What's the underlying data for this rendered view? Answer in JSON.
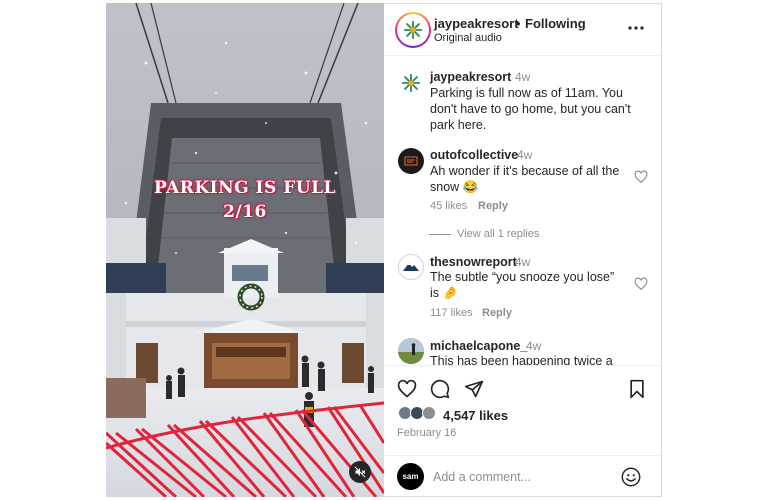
{
  "video": {
    "overlay_line1": "PARKING IS FULL",
    "overlay_line2": "2/16",
    "mute_icon": "speaker-muted-icon"
  },
  "header": {
    "username": "jaypeakresort",
    "separator": "•",
    "follow_status": "Following",
    "audio": "Original audio",
    "more_icon": "more-horizontal-icon"
  },
  "caption": {
    "username": "jaypeakresort",
    "time": "4w",
    "text": "Parking is full now as of 11am. You don't have to go home, but you can't park here."
  },
  "comments": [
    {
      "username": "outofcollective",
      "time": "4w",
      "text": "Ah wonder if it's because of all the snow 😂",
      "likes": "45 likes",
      "reply": "Reply",
      "view_replies": "View all 1 replies"
    },
    {
      "username": "thesnowreport",
      "time": "4w",
      "text": "The subtle “you snooze you lose” is 🤌",
      "likes": "117 likes",
      "reply": "Reply"
    },
    {
      "username": "michaelcapone_",
      "time": "4w",
      "text": "This has been happening twice a"
    }
  ],
  "actions": {
    "like_icon": "heart-icon",
    "comment_icon": "comment-icon",
    "share_icon": "paper-plane-icon",
    "save_icon": "bookmark-icon",
    "likes_count": "4,547 likes",
    "date": "February 16"
  },
  "add_comment": {
    "avatar_text": "sam",
    "placeholder": "Add a comment...",
    "emoji_icon": "smiley-icon"
  },
  "colors": {
    "overlay_text_glow": "#d01e4a",
    "netting": "#e0253a",
    "text_primary": "#262626",
    "text_secondary": "#8e8e8e"
  }
}
